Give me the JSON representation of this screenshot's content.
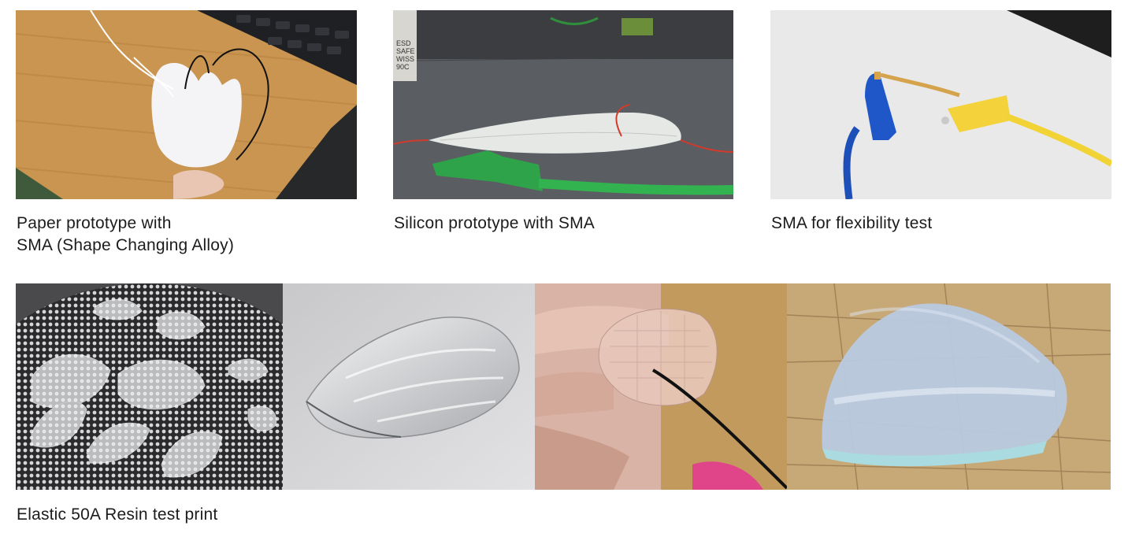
{
  "top_row": [
    {
      "caption_lines": [
        "Paper prototype with",
        "SMA (Shape Changing Alloy)"
      ],
      "image": "paper-prototype-photo"
    },
    {
      "caption_lines": [
        "Silicon prototype with SMA"
      ],
      "image": "silicon-prototype-photo"
    },
    {
      "caption_lines": [
        "SMA for flexibility test"
      ],
      "image": "sma-flexibility-photo"
    }
  ],
  "bottom_row": {
    "caption": "Elastic 50A Resin test print",
    "images": [
      "resin-prints-tray-photo",
      "resin-leaf-render",
      "resin-leaf-in-hand-photo",
      "resin-leaf-on-wood-photo"
    ]
  },
  "photo_text": {
    "silicon_label_lines": [
      "ESD",
      "SAFE",
      "WISS",
      "90C"
    ]
  }
}
